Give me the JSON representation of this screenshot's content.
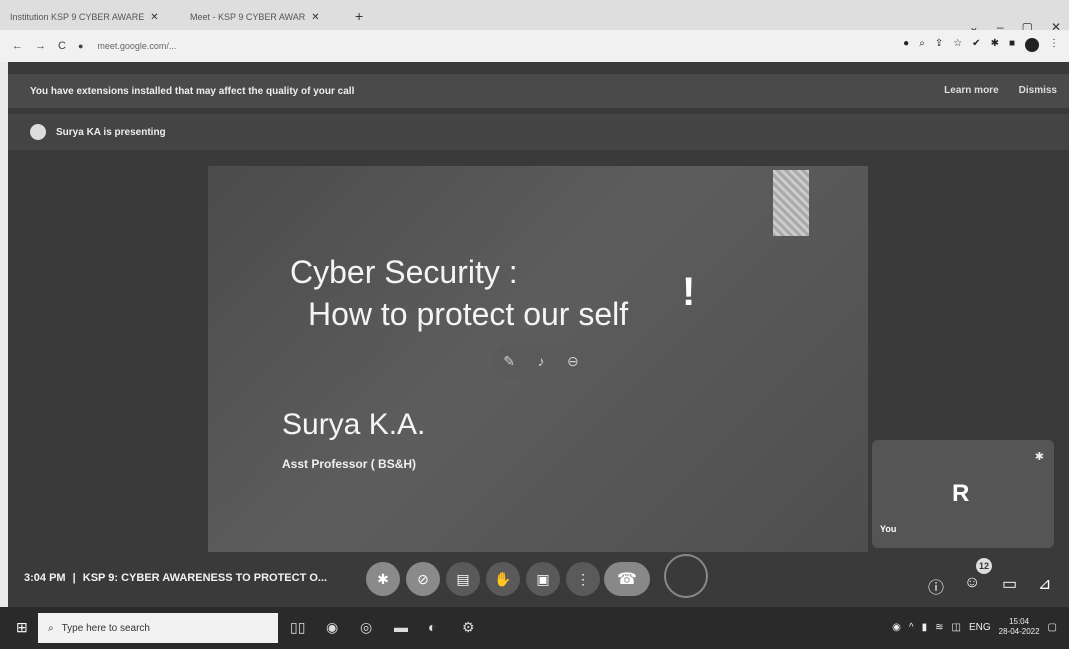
{
  "browser": {
    "tabs": [
      {
        "label": "Institution KSP 9 CYBER AWARE"
      },
      {
        "label": "Meet - KSP 9 CYBER AWAR"
      }
    ],
    "new_tab": "+",
    "window_controls": [
      "⌄",
      "–",
      "▢",
      "✕"
    ],
    "nav": {
      "back": "←",
      "forward": "→",
      "reload": "C"
    },
    "url": "meet.google.com/..."
  },
  "meet": {
    "banner": {
      "text": "You have extensions installed that may affect the quality of your call",
      "learn_more": "Learn more",
      "dismiss": "Dismiss"
    },
    "presenting_text": "Surya KA is presenting",
    "slide": {
      "title_line1": "Cyber Security :",
      "title_line2": "How to protect our self",
      "mark": "!",
      "name": "Surya K.A.",
      "role": "Asst Professor ( BS&H)"
    },
    "self_tile": {
      "initial": "R",
      "label": "You"
    },
    "bottom": {
      "time": "3:04 PM",
      "separator": "|",
      "meeting_title": "KSP 9: CYBER AWARENESS TO PROTECT O..."
    },
    "people_count": "12"
  },
  "taskbar": {
    "search_placeholder": "Type here to search",
    "tray": {
      "lang": "ENG",
      "time": "15:04",
      "date": "28-04-2022"
    }
  },
  "colors": {
    "meet_bg": "#3a3a3a",
    "tile_bg": "#555555",
    "hangup": "#888888"
  }
}
